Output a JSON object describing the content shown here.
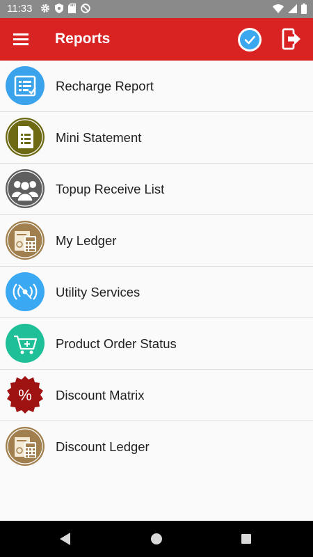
{
  "status_bar": {
    "time": "11:33",
    "icons": [
      "gear-icon",
      "shield-icon",
      "sd-card-icon",
      "no-disturb-icon",
      "wifi-icon",
      "signal-icon",
      "battery-icon"
    ]
  },
  "app_bar": {
    "title": "Reports",
    "menu_icon": "hamburger-icon",
    "action_icons": [
      "check-icon",
      "logout-icon"
    ],
    "color": "#d92323"
  },
  "reports": [
    {
      "label": "Recharge Report",
      "icon": "recharge-report-icon",
      "color": "#3ba3ec"
    },
    {
      "label": "Mini Statement",
      "icon": "mini-statement-icon",
      "color": "#6e6a14"
    },
    {
      "label": "Topup Receive List",
      "icon": "users-group-icon",
      "color": "#5f5f5f"
    },
    {
      "label": "My Ledger",
      "icon": "ledger-calculator-icon",
      "color": "#a17f4e"
    },
    {
      "label": "Utility Services",
      "icon": "signal-waves-icon",
      "color": "#3aa8f3"
    },
    {
      "label": "Product Order Status",
      "icon": "shopping-cart-icon",
      "color": "#1fbf98"
    },
    {
      "label": "Discount Matrix",
      "icon": "percent-badge-icon",
      "color": "#9e1212"
    },
    {
      "label": "Discount Ledger",
      "icon": "ledger-calculator-icon",
      "color": "#a17f4e"
    }
  ],
  "nav_bar": {
    "buttons": [
      "back-icon",
      "home-icon",
      "recent-apps-icon"
    ]
  }
}
